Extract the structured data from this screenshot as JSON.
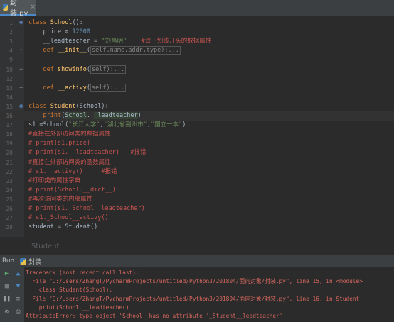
{
  "tab": {
    "label": "封装.py",
    "close": "×"
  },
  "editor": {
    "lines": [
      {
        "n": "1",
        "parts": [
          [
            "kw",
            "class "
          ],
          [
            "fn",
            "School"
          ],
          [
            "",
            "():"
          ]
        ]
      },
      {
        "n": "2",
        "parts": [
          [
            "",
            "    price = "
          ],
          [
            "num",
            "12000"
          ]
        ]
      },
      {
        "n": "3",
        "parts": [
          [
            "",
            "    __leadteacher = "
          ],
          [
            "str",
            "\"刘昌明\""
          ],
          [
            "",
            "    "
          ],
          [
            "cm",
            "#双下划线开头的数据属性"
          ]
        ]
      },
      {
        "n": "4",
        "parts": [
          [
            "",
            "    "
          ],
          [
            "kw",
            "def "
          ],
          [
            "fn",
            "__init__"
          ],
          [
            "",
            "("
          ],
          [
            "fold-box",
            "self,name,addr,type):..."
          ]
        ]
      },
      {
        "n": "9",
        "parts": []
      },
      {
        "n": "10",
        "parts": [
          [
            "",
            "    "
          ],
          [
            "kw",
            "def "
          ],
          [
            "fn",
            "showinfo"
          ],
          [
            "",
            "("
          ],
          [
            "fold-box",
            "self):..."
          ]
        ]
      },
      {
        "n": "12",
        "parts": []
      },
      {
        "n": "13",
        "parts": [
          [
            "",
            "    "
          ],
          [
            "kw",
            "def "
          ],
          [
            "fn",
            "__activy"
          ],
          [
            "",
            "("
          ],
          [
            "fold-box",
            "self):..."
          ]
        ]
      },
      {
        "n": "14",
        "parts": []
      },
      {
        "n": "15",
        "parts": [
          [
            "kw",
            "class "
          ],
          [
            "fn",
            "Student"
          ],
          [
            "",
            "(School):"
          ]
        ]
      },
      {
        "n": "16",
        "parts": [
          [
            "",
            "    "
          ],
          [
            "kw",
            "print"
          ],
          [
            "",
            "("
          ],
          [
            "hl",
            "School"
          ],
          [
            "",
            "._"
          ],
          [
            "hl",
            "_leadteacher"
          ],
          [
            "",
            ")"
          ]
        ]
      },
      {
        "n": "17",
        "parts": [
          [
            "",
            "s1 =School("
          ],
          [
            "str",
            "\"长江大学\""
          ],
          [
            "",
            ","
          ],
          [
            "str",
            "\"湖北省荆州市\""
          ],
          [
            "",
            ","
          ],
          [
            "str",
            "\"国立一本\""
          ],
          [
            "",
            ")"
          ]
        ]
      },
      {
        "n": "18",
        "parts": [
          [
            "cm",
            "#直接在外部访问类的数据属性"
          ]
        ]
      },
      {
        "n": "19",
        "parts": [
          [
            "cm",
            "# print(s1.price)"
          ]
        ]
      },
      {
        "n": "20",
        "parts": [
          [
            "cm",
            "# print(s1.__leadteacher)   #报错"
          ]
        ]
      },
      {
        "n": "21",
        "parts": [
          [
            "cm",
            "#直接在外部访问类的函数属性"
          ]
        ]
      },
      {
        "n": "22",
        "parts": [
          [
            "cm",
            "# s1.__activy()     #报错"
          ]
        ]
      },
      {
        "n": "23",
        "parts": [
          [
            "cm",
            "#打印类的属性字典"
          ]
        ]
      },
      {
        "n": "24",
        "parts": [
          [
            "cm",
            "# print(School.__dict__)"
          ]
        ]
      },
      {
        "n": "25",
        "parts": [
          [
            "cm",
            "#再次访问类的内部属性"
          ]
        ]
      },
      {
        "n": "26",
        "parts": [
          [
            "cm",
            "# print(s1._School__leadteacher)"
          ]
        ]
      },
      {
        "n": "27",
        "parts": [
          [
            "cm",
            "# s1._School__activy()"
          ]
        ]
      },
      {
        "n": "28",
        "parts": [
          [
            "",
            "student = Student()"
          ]
        ]
      }
    ],
    "ghost_text": "Student"
  },
  "run": {
    "title": "Run",
    "tab_label": "封装",
    "console_lines": [
      "Traceback (most recent call last):",
      "  File \"C:/Users/ZhangT/PycharmProjects/untitled/Python3/201804/面向对象/封装.py\", line 15, in <module>",
      "    class Student(School):",
      "  File \"C:/Users/ZhangT/PycharmProjects/untitled/Python3/201804/面向对象/封装.py\", line 16, in Student",
      "    print(School.__leadteacher)",
      "AttributeError: type object 'School' has no attribute '_Student__leadteacher'"
    ]
  },
  "colors": {
    "accent": "#4a88c7",
    "error": "#d8685f",
    "keyword": "#cc7832",
    "function": "#ffc66d",
    "string": "#6a8759"
  }
}
